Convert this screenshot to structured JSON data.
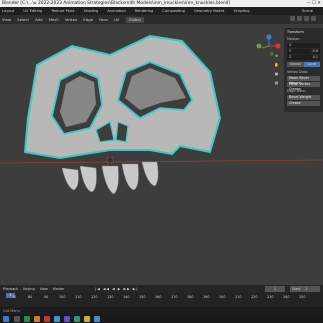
{
  "title_bar": {
    "text": "Blender [C:\\...\\u 2022-2023 Animation Strategies\\Blacksmith Models\\iron_knuckles\\iron_knuckles.blend]",
    "window_controls": "—  ☐  ✕"
  },
  "workspaces": [
    "Layout",
    "UV Editing",
    "Texture Paint",
    "Shading",
    "Animation",
    "Rendering",
    "Compositing",
    "Geometry Nodes",
    "Scripting"
  ],
  "scene": "Scene",
  "header": {
    "menus": [
      "View",
      "Select",
      "Add",
      "Mesh",
      "Vertex",
      "Edge",
      "Face",
      "UV"
    ],
    "orientation": "Global"
  },
  "n_panel": {
    "header": "Transform",
    "section": "Median:",
    "fields": [
      {
        "label": "X",
        "value": ""
      },
      {
        "label": "Y",
        "value": "-0.6"
      },
      {
        "label": "Z",
        "value": "0.1"
      }
    ],
    "global_label": "Global",
    "local_label": "Local",
    "vertex_data": "Vertex Data:",
    "mean_bevel_weight": "Mean Bevel Weight",
    "mean_vertex_crease": "Mean Vertex Crease",
    "edge_data": "Edge Data:",
    "bevel_weight": "Bevel Weight",
    "crease": "Crease"
  },
  "timeline": {
    "menus": [
      "Playback",
      "Keying",
      "View",
      "Marker"
    ],
    "transport": "|◀ ◀◀ ◀ ▶ ▶▶ ▶|",
    "current_frame": "1",
    "start_label": "Start",
    "start_value": "1",
    "ticks": [
      "70",
      "80",
      "90",
      "100",
      "110",
      "120",
      "130",
      "140",
      "150",
      "160",
      "170",
      "180",
      "190",
      "200",
      "210",
      "220",
      "230",
      "240",
      "250"
    ],
    "cursor": "1"
  },
  "status": "Call Menu",
  "colors": {
    "mesh": "#b8b8b8",
    "mesh_dark": "#8e8e8e",
    "outline": "#3fc7c3",
    "grid_x": "#9a3b3b",
    "grid_y": "#6a8a38"
  }
}
